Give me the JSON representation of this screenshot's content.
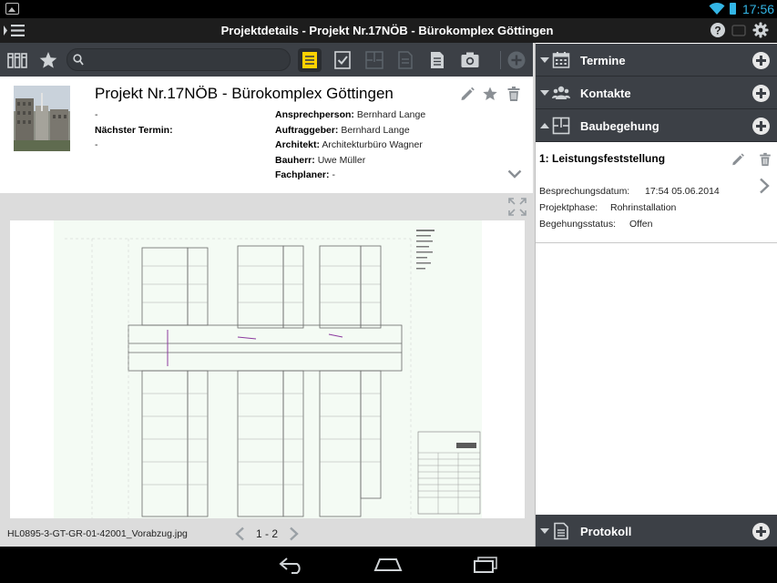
{
  "status": {
    "time": "17:56"
  },
  "actionbar": {
    "title": "Projektdetails - Projekt Nr.17NÖB - Bürokomplex Göttingen"
  },
  "search": {
    "value": "",
    "placeholder": ""
  },
  "project": {
    "title": "Projekt Nr.17NÖB - Bürokomplex Göttingen",
    "left_value": "-",
    "next_date_label": "Nächster Termin:",
    "next_date_value": "-",
    "fields": [
      {
        "label": "Ansprechperson:",
        "value": "Bernhard Lange"
      },
      {
        "label": "Auftraggeber:",
        "value": "Bernhard Lange"
      },
      {
        "label": "Architekt:",
        "value": "Architekturbüro Wagner"
      },
      {
        "label": "Bauherr:",
        "value": "Uwe Müller"
      },
      {
        "label": "Fachplaner:",
        "value": "-"
      }
    ]
  },
  "viewer": {
    "filename": "HL0895-3-GT-GR-01-42001_Vorabzug.jpg",
    "pager": "1 - 2"
  },
  "sidebar": {
    "sections": [
      {
        "label": "Termine",
        "icon": "calendar-icon"
      },
      {
        "label": "Kontakte",
        "icon": "contacts-icon"
      },
      {
        "label": "Baubegehung",
        "icon": "floorplan-icon"
      },
      {
        "label": "Protokoll",
        "icon": "document-icon"
      }
    ],
    "baubegehung": {
      "title": "1: Leistungsfeststellung",
      "rows": [
        {
          "label": "Besprechungsdatum:",
          "value": "17:54 05.06.2014"
        },
        {
          "label": "Projektphase:",
          "value": "Rohrinstallation"
        },
        {
          "label": "Begehungsstatus:",
          "value": "Offen"
        }
      ]
    }
  },
  "colors": {
    "accent": "#33b5e5",
    "toolbar": "#3c4046",
    "highlight": "#ffd200"
  }
}
